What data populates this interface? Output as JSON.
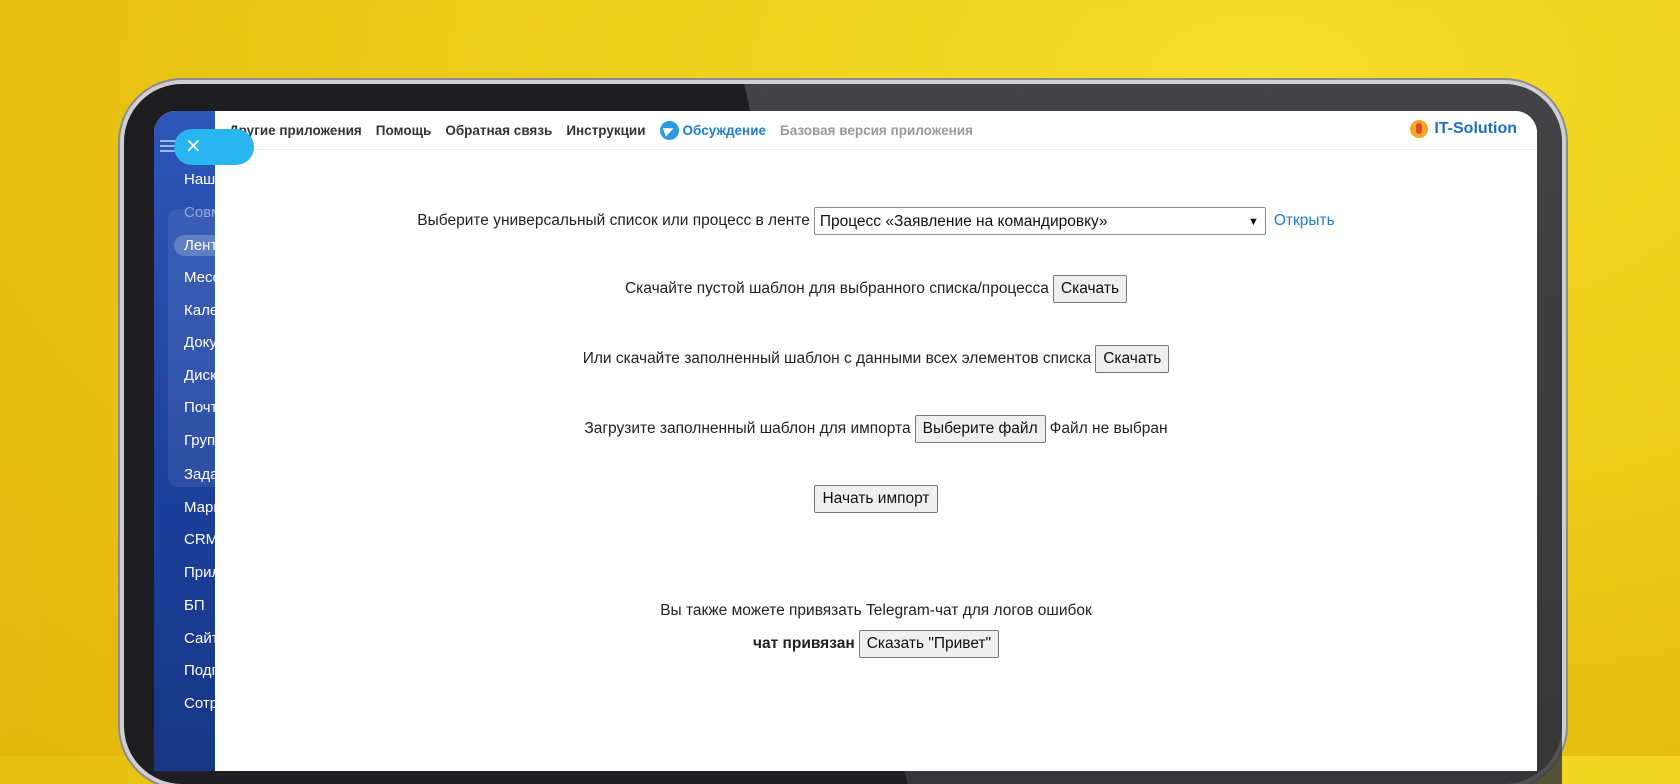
{
  "sidebar": {
    "items": [
      {
        "label": "Наш"
      },
      {
        "label": "Совм"
      },
      {
        "label": "Лент"
      },
      {
        "label": "Месс"
      },
      {
        "label": "Кале"
      },
      {
        "label": "Доку"
      },
      {
        "label": "Диск"
      },
      {
        "label": "Почт"
      },
      {
        "label": "Груп"
      },
      {
        "label": "Зада"
      },
      {
        "label": "Марк"
      },
      {
        "label": "CRM"
      },
      {
        "label": "Прил"
      },
      {
        "label": "БП"
      },
      {
        "label": "Сайт"
      },
      {
        "label": "Подп"
      },
      {
        "label": "Сотр"
      }
    ],
    "close_label": "×"
  },
  "topnav": {
    "links": [
      "Другие приложения",
      "Помощь",
      "Обратная связь",
      "Инструкции"
    ],
    "discuss": "Обсуждение",
    "base_version": "Базовая версия приложения",
    "logo": "IT-Solution"
  },
  "form": {
    "select_label": "Выберите универсальный список или процесс в ленте",
    "select_value": "Процесс «Заявление на командировку»",
    "open_link": "Открыть",
    "download_empty_label": "Скачайте пустой шаблон для выбранного списка/процесса",
    "download_button": "Скачать",
    "download_filled_label": "Или скачайте заполненный шаблон с данными всех элементов списка",
    "download_filled_button": "Скачать",
    "upload_label": "Загрузите заполненный шаблон для импорта",
    "choose_file_button": "Выберите файл",
    "no_file": "Файл не выбран",
    "start_import": "Начать импорт",
    "telegram_label": "Вы также можете привязать Telegram-чат для логов ошибок",
    "chat_status": "чат привязан",
    "say_hello": "Сказать \"Привет\""
  },
  "colors": {
    "accent": "#1e7ed6",
    "sidebar": "#1c3f9a",
    "close_pill": "#29b6f0",
    "background": "#efd21e"
  }
}
